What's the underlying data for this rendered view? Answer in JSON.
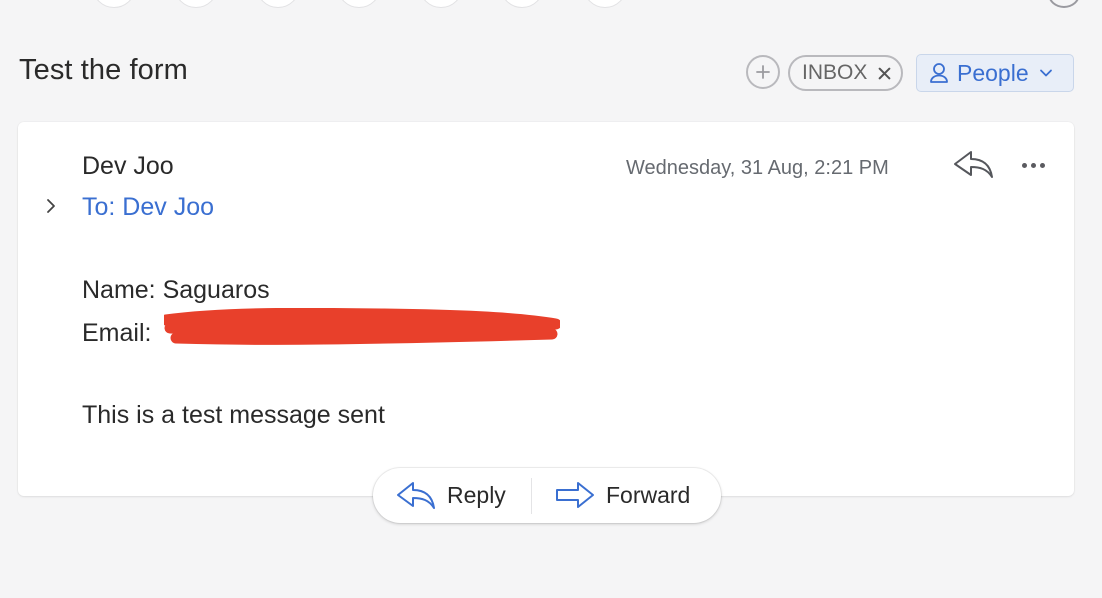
{
  "thread": {
    "subject": "Test the form"
  },
  "labels": {
    "add_label_icon": "plus-icon",
    "chip": {
      "label": "INBOX",
      "remove_icon": "close-icon"
    },
    "people_button": {
      "label": "People",
      "icon": "person-icon",
      "chevron": "chevron-down-icon"
    }
  },
  "message": {
    "sender": "Dev Joo",
    "to": "To: Dev Joo",
    "date": "Wednesday, 31 Aug, 2:21 PM",
    "body": {
      "name_line": "Name: Saguaros",
      "email_label": "Email: ",
      "message_line": "This is a test message sent"
    }
  },
  "actions": {
    "reply_label": "Reply",
    "forward_label": "Forward"
  },
  "colors": {
    "accent": "#3a6fd1",
    "background": "#f5f5f6",
    "card": "#ffffff",
    "redaction": "#e8402b"
  }
}
